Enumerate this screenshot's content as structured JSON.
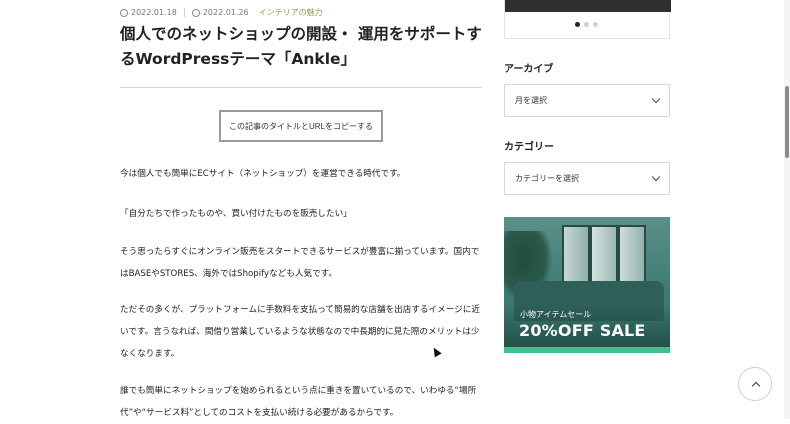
{
  "article": {
    "meta": {
      "published": "2022.01.18",
      "updated": "2022.01.26",
      "category": "インテリアの魅力"
    },
    "title": "個人でのネットショップの開設・ 運用をサポートするWordPressテーマ「Ankle」",
    "copy_button_label": "この記事のタイトルとURLをコピーする",
    "paragraphs": [
      "今は個人でも簡単にECサイト（ネットショップ）を運営できる時代です。",
      "「自分たちで作ったものや、買い付けたものを販売したい」",
      "そう思ったらすぐにオンライン販売をスタートできるサービスが豊富に揃っています。国内ではBASEやSTORES、海外ではShopifyなども人気です。",
      "ただその多くが、プラットフォームに手数料を支払って簡易的な店舗を出店するイメージに近いです。言うなれば、間借り営業しているような状態なので中長期的に見た際のメリットは少なくなります。",
      "誰でも簡単にネットショップを始められるという点に重きを置いているので、いわゆる“場所代”や“サービス料”としてのコストを支払い続ける必要があるからです。"
    ]
  },
  "sidebar": {
    "slider_dots": 3,
    "slider_active": 0,
    "archive": {
      "heading": "アーカイブ",
      "select_value": "月を選択"
    },
    "category": {
      "heading": "カテゴリー",
      "select_value": "カテゴリーを選択"
    },
    "banner": {
      "subtitle": "小物アイテムセール",
      "headline": "20%OFF SALE"
    }
  },
  "icons": {
    "published": "clock-icon",
    "updated": "refresh-icon",
    "select": "chevron-down-icon",
    "back_to_top": "chevron-up-icon"
  },
  "colors": {
    "category_text": "#9a9a55",
    "banner_green": "#3f7e76",
    "banner_stripe": "#3fbf8f"
  }
}
